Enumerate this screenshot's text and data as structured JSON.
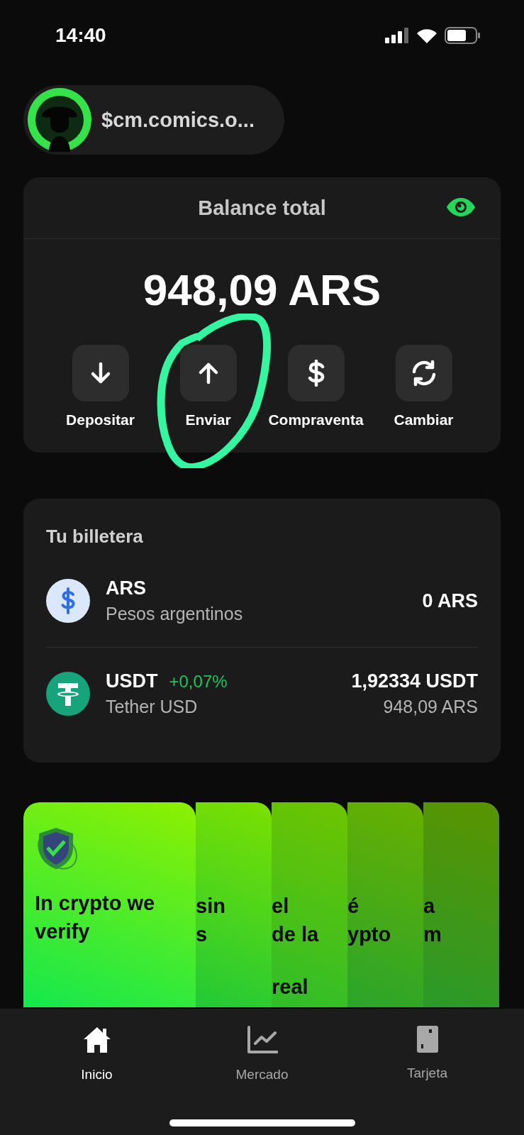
{
  "status_bar": {
    "time": "14:40"
  },
  "profile": {
    "handle": "$cm.comics.o..."
  },
  "balance": {
    "title": "Balance total",
    "amount": "948,09 ARS",
    "actions": [
      {
        "label": "Depositar",
        "kind": "down"
      },
      {
        "label": "Enviar",
        "kind": "up"
      },
      {
        "label": "Compraventa",
        "kind": "dollar"
      },
      {
        "label": "Cambiar",
        "kind": "swap"
      }
    ]
  },
  "wallet": {
    "title": "Tu billetera",
    "assets": [
      {
        "kind": "ars",
        "symbol": "ARS",
        "name": "Pesos argentinos",
        "amount": "0 ARS"
      },
      {
        "kind": "usdt",
        "symbol": "USDT",
        "change": "+0,07%",
        "name": "Tether USD",
        "amount": "1,92334 USDT",
        "value": "948,09 ARS"
      }
    ]
  },
  "promo_cards": [
    {
      "kind": "front",
      "lines": [
        "In crypto we",
        "verify"
      ]
    },
    {
      "kind": "behind",
      "lines": [
        "sin",
        "s"
      ]
    },
    {
      "kind": "behind",
      "lines": [
        "el",
        "de la"
      ],
      "bottom_line": "real"
    },
    {
      "kind": "behind",
      "lines": [
        "é",
        "ypto"
      ]
    },
    {
      "kind": "behind",
      "lines": [
        "a",
        "m"
      ]
    }
  ],
  "nav": [
    {
      "kind": "home",
      "label": "Inicio",
      "selected": true
    },
    {
      "kind": "chart",
      "label": "Mercado",
      "selected": false
    },
    {
      "kind": "card",
      "label": "Tarjeta",
      "selected": false
    }
  ]
}
